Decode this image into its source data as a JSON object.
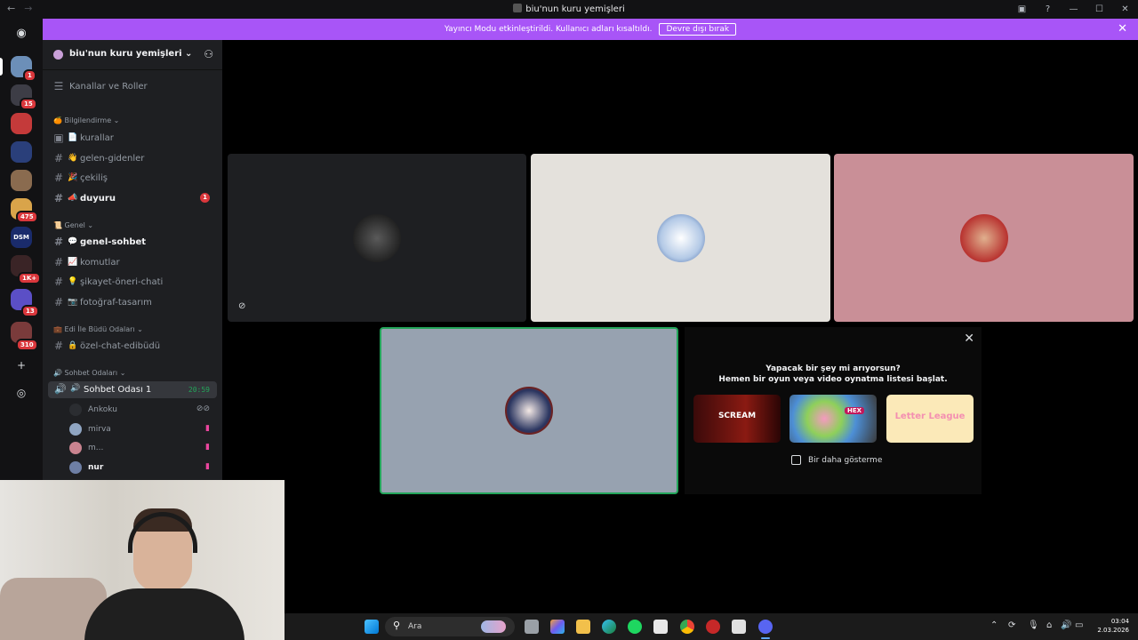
{
  "window": {
    "title": "biu'nun kuru yemişleri",
    "back_icon": "arrow-left-icon",
    "forward_icon": "arrow-right-icon"
  },
  "banner": {
    "text": "Yayıncı Modu etkinleştirildi. Kullanıcı adları kısaltıldı.",
    "button": "Devre dışı bırak",
    "bg": "#a855f7"
  },
  "guild_badges": [
    "1",
    "15",
    "475",
    "1K+",
    "13",
    "310"
  ],
  "server": {
    "name": "biu'nun kuru yemişleri",
    "channels_roles": "Kanallar ve Roller",
    "categories": [
      {
        "name": "Bilgilendirme",
        "channels": [
          {
            "name": "kurallar",
            "emoji": "📄"
          },
          {
            "name": "gelen-gidenler",
            "emoji": "👋"
          },
          {
            "name": "çekiliş",
            "emoji": "🎉"
          },
          {
            "name": "duyuru",
            "emoji": "📣",
            "badge": "1"
          }
        ]
      },
      {
        "name": "Genel",
        "channels": [
          {
            "name": "genel-sohbet",
            "emoji": "💬"
          },
          {
            "name": "komutlar",
            "emoji": "📈"
          },
          {
            "name": "şikayet-öneri-chati",
            "emoji": "💡"
          },
          {
            "name": "fotoğraf-tasarım",
            "emoji": "📷"
          }
        ]
      },
      {
        "name": "Edi İle Büdü Odaları",
        "channels": [
          {
            "name": "özel-chat-edibüdü",
            "emoji": "🔒"
          }
        ]
      },
      {
        "name": "Sohbet Odaları"
      }
    ],
    "voice_channel": {
      "name": "Sohbet Odası 1",
      "timer": "20:59",
      "users": [
        "Ankoku",
        "mirva",
        "m...",
        "nur"
      ]
    }
  },
  "activity": {
    "title": "Yapacak bir şey mi arıyorsun?",
    "subtitle": "Hemen bir oyun veya video oynatma listesi başlat.",
    "games": [
      "SCREAM",
      "HEX",
      "Letter League"
    ],
    "dont_show": "Bir daha gösterme"
  },
  "taskbar": {
    "search": "Ara",
    "time": "03:04",
    "date": "2.03.2026"
  }
}
